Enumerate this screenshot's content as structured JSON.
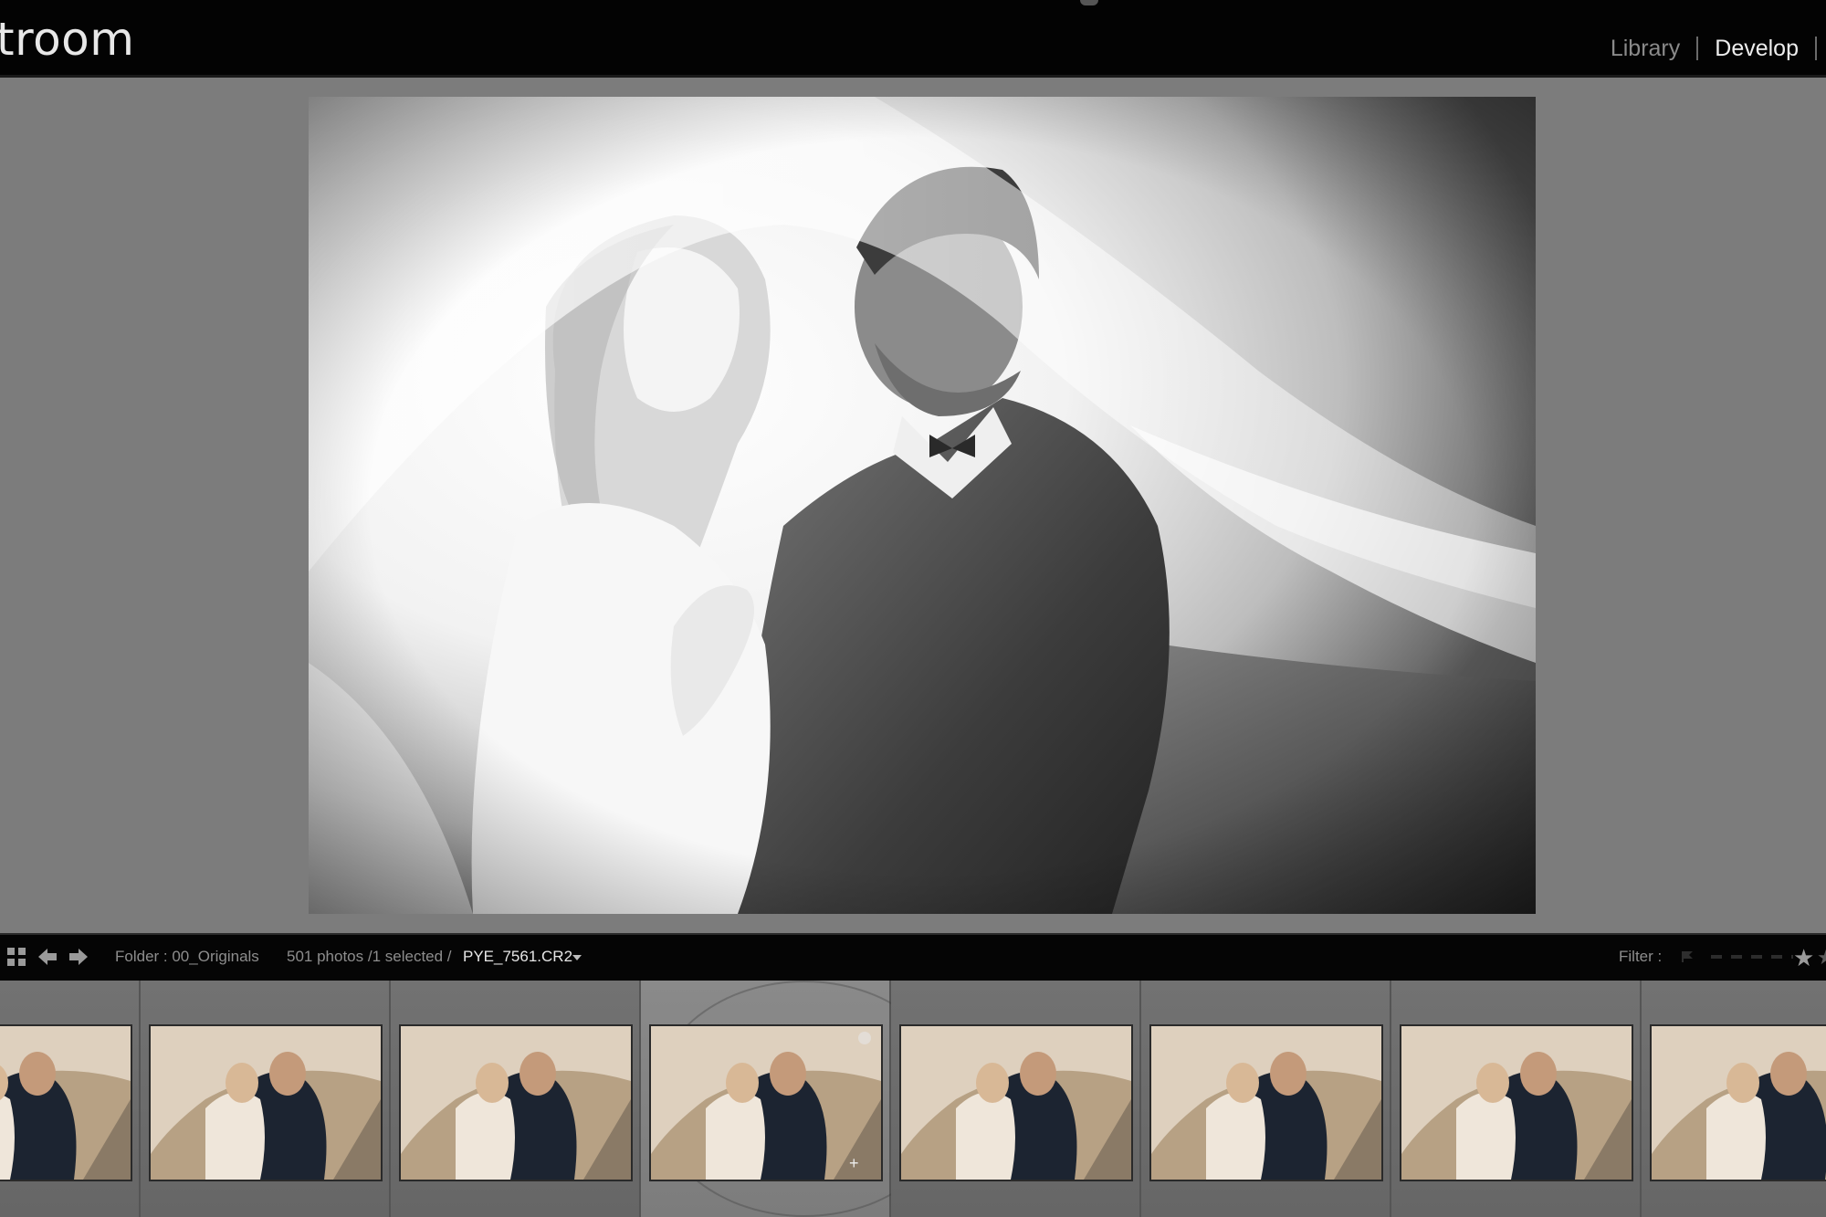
{
  "header": {
    "app_title": "troom",
    "modules": [
      {
        "label": "Library",
        "active": false
      },
      {
        "label": "Develop",
        "active": true
      }
    ]
  },
  "photo": {
    "description_icon": "main-photo-preview",
    "style": "black-and-white"
  },
  "filmstrip_toolbar": {
    "folder": "Folder : 00_Originals",
    "count": "501 photos /1 selected /",
    "filename": "PYE_7561.CR2",
    "filter_label": "Filter :"
  },
  "filmstrip": {
    "selected_index": 3,
    "thumbnail_count": 8
  },
  "colors": {
    "topbar": "#030303",
    "background": "#7c7c7c",
    "active_module": "#ededed",
    "inactive_module": "#8a8a8a",
    "thumb_tone": "#b39a7c"
  }
}
